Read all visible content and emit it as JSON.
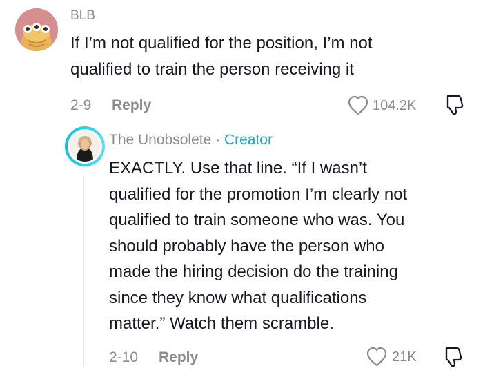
{
  "comments": [
    {
      "username": "BLB",
      "text_lines": [
        "If I’m not qualified for the position, I’m not",
        "qualified to train the person receiving it"
      ],
      "date": "2-9",
      "reply_label": "Reply",
      "likes": "104.2K",
      "icons": {
        "like": "heart-outline-icon",
        "dislike": "thumbs-down-icon"
      }
    }
  ],
  "reply": {
    "username": "The Unobsolete",
    "separator": "·",
    "badge": "Creator",
    "text_lines": [
      "EXACTLY. Use that line. “If I wasn’t",
      "qualified for the promotion I’m clearly not",
      "qualified to train someone who was. You",
      "should probably have the person who",
      "made the hiring decision do the training",
      "since they know what qualifications",
      "matter.” Watch them scramble."
    ],
    "date": "2-10",
    "reply_label": "Reply",
    "likes": "21K",
    "icons": {
      "like": "heart-outline-icon",
      "dislike": "thumbs-down-icon"
    }
  },
  "colors": {
    "text": "#161823",
    "muted": "#8a8b91",
    "creator_badge": "#1ba6c2",
    "avatar_ring": "#20d5ec"
  }
}
